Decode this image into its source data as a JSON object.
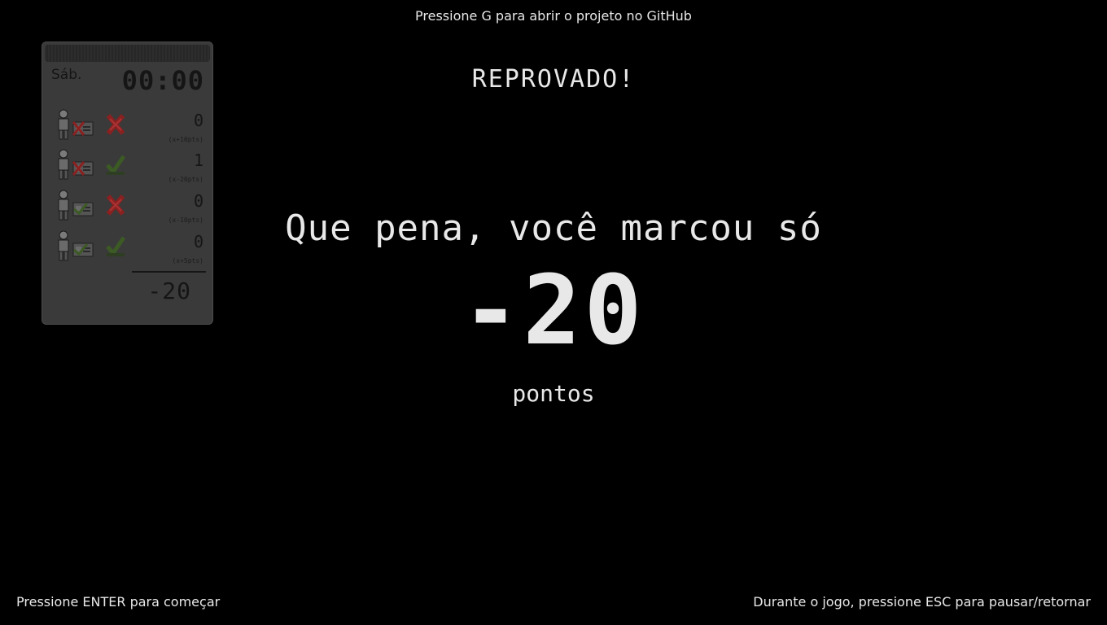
{
  "hints": {
    "top": "Pressione G para abrir o projeto no GitHub",
    "bottom_left": "Pressione ENTER para começar",
    "bottom_right": "Durante o jogo, pressione ESC para pausar/retornar"
  },
  "result": {
    "status": "REPROVADO!",
    "message": "Que pena, você marcou só",
    "score": "-20",
    "unit": "pontos"
  },
  "panel": {
    "day": "Sáb.",
    "time": "00:00",
    "rows": [
      {
        "doc_ok": false,
        "verdict_ok": false,
        "count": "0",
        "mult": "(x+10pts)"
      },
      {
        "doc_ok": false,
        "verdict_ok": true,
        "count": "1",
        "mult": "(x-20pts)"
      },
      {
        "doc_ok": true,
        "verdict_ok": false,
        "count": "0",
        "mult": "(x-10pts)"
      },
      {
        "doc_ok": true,
        "verdict_ok": true,
        "count": "0",
        "mult": "(x+5pts)"
      }
    ],
    "total": "-20"
  },
  "colors": {
    "background": "#000000",
    "text": "#e8e8e8",
    "panel": "#3a3a3a",
    "reject": "#8a2020",
    "approve": "#3c5a24"
  }
}
